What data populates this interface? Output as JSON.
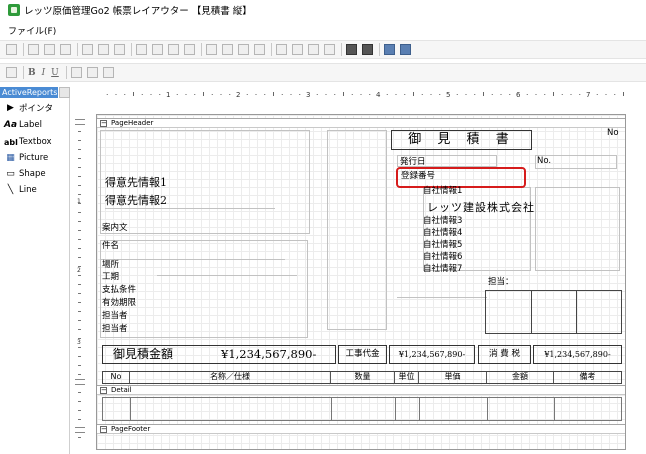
{
  "window": {
    "title": "レッツ原価管理Go2  帳票レイアウター 【見積書 縦】"
  },
  "menu": {
    "file": "ファイル(F)"
  },
  "toolbar2": {
    "bold": "B",
    "italic": "I",
    "underline": "U"
  },
  "toolbox": {
    "header": "ActiveReports",
    "items": [
      {
        "icon": "arrow-pointer-icon",
        "glyph": "▶",
        "label": "ポインタ"
      },
      {
        "icon": "label-icon",
        "glyph": "Aa",
        "label": "Label"
      },
      {
        "icon": "textbox-icon",
        "glyph": "abl",
        "label": "Textbox"
      },
      {
        "icon": "picture-icon",
        "glyph": "▦",
        "label": "Picture"
      },
      {
        "icon": "shape-icon",
        "glyph": "▭",
        "label": "Shape"
      },
      {
        "icon": "line-icon",
        "glyph": "╲",
        "label": "Line"
      }
    ]
  },
  "ruler": {
    "top_labels": [
      "1",
      "2",
      "3",
      "4",
      "5",
      "6",
      "7"
    ],
    "side_labels": [
      "1",
      "2",
      "3"
    ]
  },
  "bands": {
    "page_header": "PageHeader",
    "detail": "Detail",
    "page_footer": "PageFooter"
  },
  "report": {
    "title": "御 見 積 書",
    "no_label_top": "No",
    "issue_date_label": "発行日",
    "no_label": "No.",
    "registration_no_label": "登録番号",
    "customer_info1": "得意先情報1",
    "customer_info2": "得意先情報2",
    "own_info": [
      "自社情報1",
      "自社情報3",
      "自社情報4",
      "自社情報5",
      "自社情報6",
      "自社情報7"
    ],
    "company_name": "レッツ建設株式会社",
    "guidance": "案内文",
    "subject": "件名",
    "fields": [
      "場所",
      "工期",
      "支払条件",
      "有効期限",
      "担当者",
      "担当者"
    ],
    "staff_label": "担当：",
    "total_label": "御見積金額",
    "total_value": "¥1,234,567,890-",
    "work_cost_label": "工事代金",
    "work_cost_value": "¥1,234,567,890-",
    "tax_label": "消 費 税",
    "tax_value": "¥1,234,567,890-",
    "columns": [
      "No",
      "名称／仕様",
      "数量",
      "単位",
      "単価",
      "金額",
      "備考"
    ]
  },
  "colors": {
    "highlight": "#d61c1c",
    "toolbox_header": "#4a8bd4",
    "app_icon": "#2e9a3a"
  }
}
